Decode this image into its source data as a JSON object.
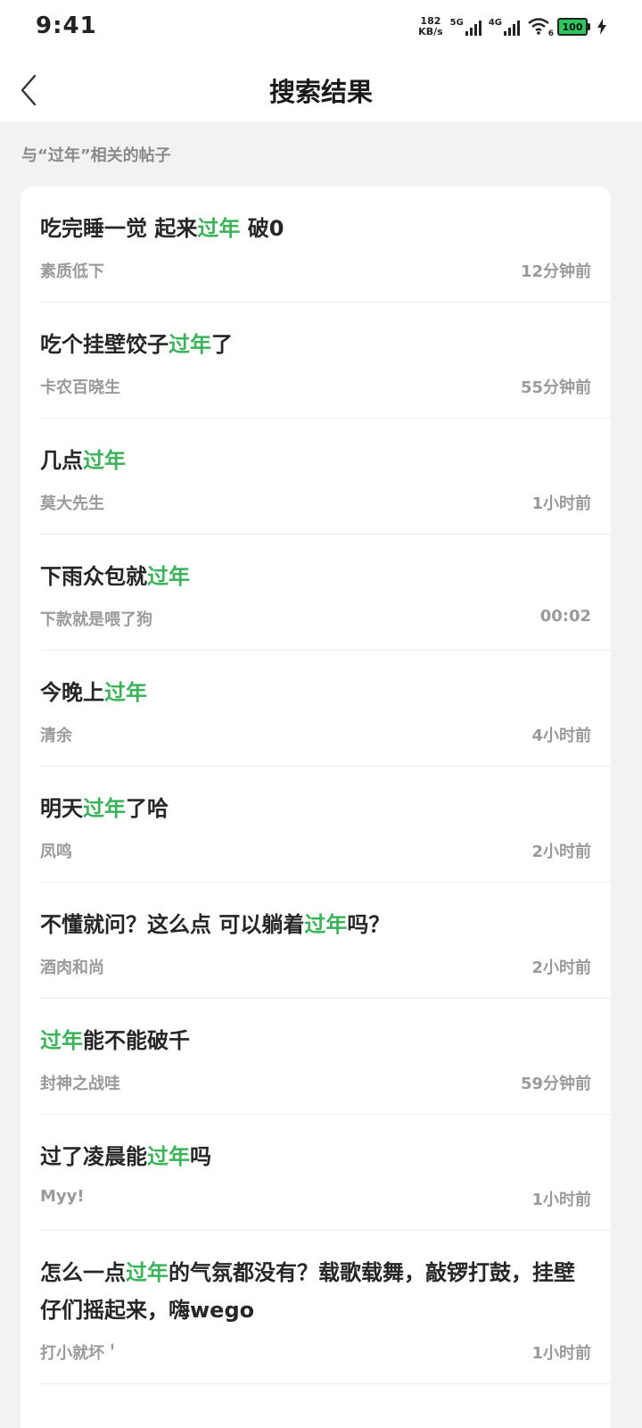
{
  "status_bar": {
    "time": "9:41",
    "net_speed_value": "182",
    "net_speed_unit": "KB/s",
    "signal1_label": "5G",
    "signal2_label": "4G",
    "wifi_sub": "6",
    "battery": "100",
    "icons": [
      "signal-icon",
      "wifi-icon",
      "battery-icon",
      "charging-icon"
    ]
  },
  "nav": {
    "title": "搜索结果",
    "back_icon": "chevron-left-icon"
  },
  "section_label": "与“过年”相关的帖子",
  "highlight_color": "#3cb25a",
  "posts": [
    {
      "title_parts": [
        "吃完睡一觉 起来",
        "过年",
        " 破0"
      ],
      "author": "素质低下",
      "time": "12分钟前"
    },
    {
      "title_parts": [
        "吃个挂壁饺子",
        "过年",
        "了"
      ],
      "author": "卡农百晓生",
      "time": "55分钟前"
    },
    {
      "title_parts": [
        "几点",
        "过年",
        ""
      ],
      "author": "莫大先生",
      "time": "1小时前"
    },
    {
      "title_parts": [
        "下雨众包就",
        "过年",
        ""
      ],
      "author": "下款就是喂了狗",
      "time": "00:02"
    },
    {
      "title_parts": [
        "今晚上",
        "过年",
        ""
      ],
      "author": "清余",
      "time": "4小时前"
    },
    {
      "title_parts": [
        "明天",
        "过年",
        "了哈"
      ],
      "author": "凤鸣",
      "time": "2小时前"
    },
    {
      "title_parts": [
        "不懂就问？这么点 可以躺着",
        "过年",
        "吗？"
      ],
      "author": "酒肉和尚",
      "time": "2小时前"
    },
    {
      "title_parts": [
        "",
        "过年",
        "能不能破千"
      ],
      "author": "封神之战哇",
      "time": "59分钟前"
    },
    {
      "title_parts": [
        "过了凌晨能",
        "过年",
        "吗"
      ],
      "author": "Myy!",
      "time": "1小时前"
    },
    {
      "title_parts": [
        "怎么一点",
        "过年",
        "的气氛都没有？载歌载舞，敲锣打鼓，挂壁仔们摇起来，嗨wego"
      ],
      "author": "打小就坏＇",
      "time": "1小时前"
    }
  ]
}
